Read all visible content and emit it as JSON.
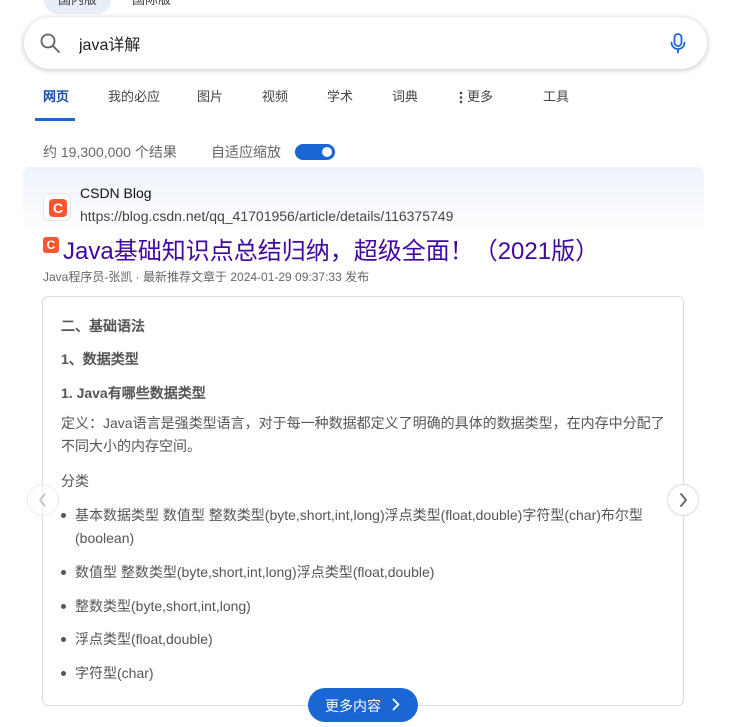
{
  "region_tabs": [
    "国内版",
    "国际版"
  ],
  "search": {
    "query": "java详解"
  },
  "nav": {
    "items": [
      "网页",
      "我的必应",
      "图片",
      "视频",
      "学术",
      "词典",
      "更多",
      "工具"
    ],
    "active_index": 0
  },
  "results_info": {
    "count": "约 19,300,000 个结果",
    "adaptive_label": "自适应缩放",
    "adaptive_on": true
  },
  "result": {
    "site_name": "CSDN Blog",
    "site_favicon_letter": "C",
    "url": "https://blog.csdn.net/qq_41701956/article/details/116375749",
    "title": "Java基础知识点总结归纳，超级全面！（2021版）",
    "meta": "Java程序员-张凯 · 最新推荐文章于 2024-01-29 09:37:33 发布",
    "content": {
      "h1": "二、基础语法",
      "h2": "1、数据类型",
      "h3": "1. Java有哪些数据类型",
      "definition": "定义：Java语言是强类型语言，对于每一种数据都定义了明确的具体的数据类型，在内存中分配了不同大小的内存空间。",
      "category_label": "分类",
      "bullets": [
        "基本数据类型 数值型 整数类型(byte,short,int,long)浮点类型(float,double)字符型(char)布尔型(boolean)",
        "数值型 整数类型(byte,short,int,long)浮点类型(float,double)",
        "整数类型(byte,short,int,long)",
        "浮点类型(float,double)",
        "字符型(char)"
      ]
    },
    "more_button": "更多内容"
  },
  "colors": {
    "accent": "#1a66d2",
    "title": "#4007a2",
    "csdn": "#fc5531"
  }
}
